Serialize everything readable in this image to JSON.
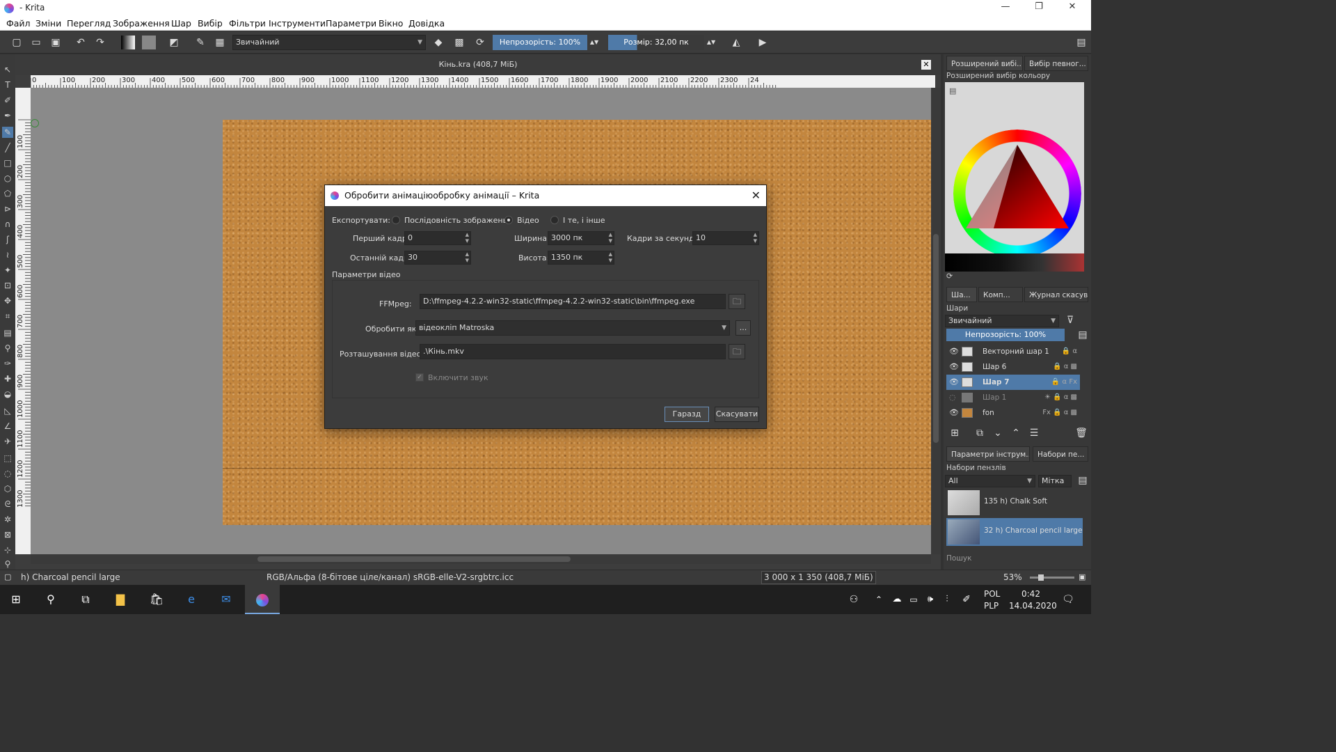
{
  "window": {
    "title": " - Krita",
    "controls": {
      "minimize": "—",
      "maximize": "❐",
      "close": "✕"
    }
  },
  "menu": [
    "Файл",
    "Зміни",
    "Перегляд",
    "Зображення",
    "Шар",
    "Вибір",
    "Фільтри",
    "Інструменти",
    "Параметри",
    "Вікно",
    "Довідка"
  ],
  "toolbar": {
    "blend_mode": "Звичайний",
    "opacity": "Непрозорість: 100%",
    "opacity_level": 1.0,
    "size": "Розмір: 32,00 пк"
  },
  "document": {
    "title": "Кінь.kra (408,7 МіБ)",
    "ruler_marks": [
      "0",
      "100",
      "200",
      "300",
      "400",
      "500",
      "600",
      "700",
      "800",
      "900",
      "1000",
      "1100",
      "1200",
      "1300",
      "1400",
      "1500",
      "1600",
      "1700",
      "1800",
      "1900",
      "2000",
      "2100",
      "2200",
      "2300",
      "24"
    ],
    "vruler_marks": [
      "100",
      "200",
      "300",
      "400",
      "500",
      "600",
      "700",
      "800",
      "900",
      "1000",
      "1100",
      "1200",
      "1300"
    ],
    "texture_color": "#c3863e"
  },
  "dialog": {
    "title": "Обробити анімаціюобробку анімації – Krita",
    "export_label": "Експортувати:",
    "export_options": [
      "Послідовність зображень",
      "Відео",
      "І те, і інше"
    ],
    "export_selected": "Відео",
    "first_frame_label": "Перший кадр:",
    "first_frame": "0",
    "last_frame_label": "Останній кадр:",
    "last_frame": "30",
    "width_label": "Ширина:",
    "width": "3000 пк",
    "height_label": "Висота:",
    "height": "1350 пк",
    "fps_label": "Кадри за секунду:",
    "fps": "10",
    "video_params_label": "Параметри відео",
    "ffmpeg_label": "FFMpeg:",
    "ffmpeg_path": "D:\\ffmpeg-4.2.2-win32-static\\ffmpeg-4.2.2-win32-static\\bin\\ffmpeg.exe",
    "render_as_label": "Обробити як:",
    "render_as": "відеокліп Matroska",
    "more_button": "...",
    "location_label": "Розташування відео:",
    "location": ".\\Кінь.mkv",
    "include_audio": "Включити звук",
    "ok": "Гаразд",
    "cancel": "Скасувати"
  },
  "dock": {
    "top_tabs": [
      "Розширений вибі...",
      "Вибір певног..."
    ],
    "color_panel_title": "Розширений вибір кольору",
    "mid_tabs": [
      "Ша...",
      "Комп...",
      "Журнал скасув..."
    ],
    "layers_title": "Шари",
    "layers_blend": "Звичайний",
    "layers_opacity": "Непрозорість:  100%",
    "layers": [
      {
        "name": "Векторний шар 1",
        "visible": true,
        "selected": false,
        "thumb": "#eeeeee"
      },
      {
        "name": "Шар 6",
        "visible": true,
        "selected": false,
        "thumb": "#eeeeee"
      },
      {
        "name": "Шар 7",
        "visible": true,
        "selected": true,
        "thumb": "#dddddd"
      },
      {
        "name": "Шар 1",
        "visible": false,
        "selected": false,
        "thumb": "#777777"
      },
      {
        "name": "fon",
        "visible": true,
        "selected": false,
        "thumb": "#c3863e"
      }
    ],
    "bottom_tabs": [
      "Параметри інструм...",
      "Набори пе..."
    ],
    "brush_title": "Набори пензлів",
    "brush_filter": "All",
    "brush_tag": "Мітка",
    "brushes": [
      {
        "num": "135",
        "name": "h) Chalk Soft",
        "selected": false
      },
      {
        "num": "32",
        "name": "h) Charcoal pencil large",
        "selected": true
      }
    ],
    "search": "Пошук"
  },
  "status": {
    "brush": "h) Charcoal pencil large",
    "colorspace": "RGB/Альфа (8-бітове ціле/канал)  sRGB-elle-V2-srgbtrc.icc",
    "dimensions": "3 000 x 1 350 (408,7 МіБ)",
    "zoom": "53%"
  },
  "taskbar": {
    "lang1": "POL",
    "lang2": "PLP",
    "time": "0:42",
    "date": "14.04.2020"
  }
}
